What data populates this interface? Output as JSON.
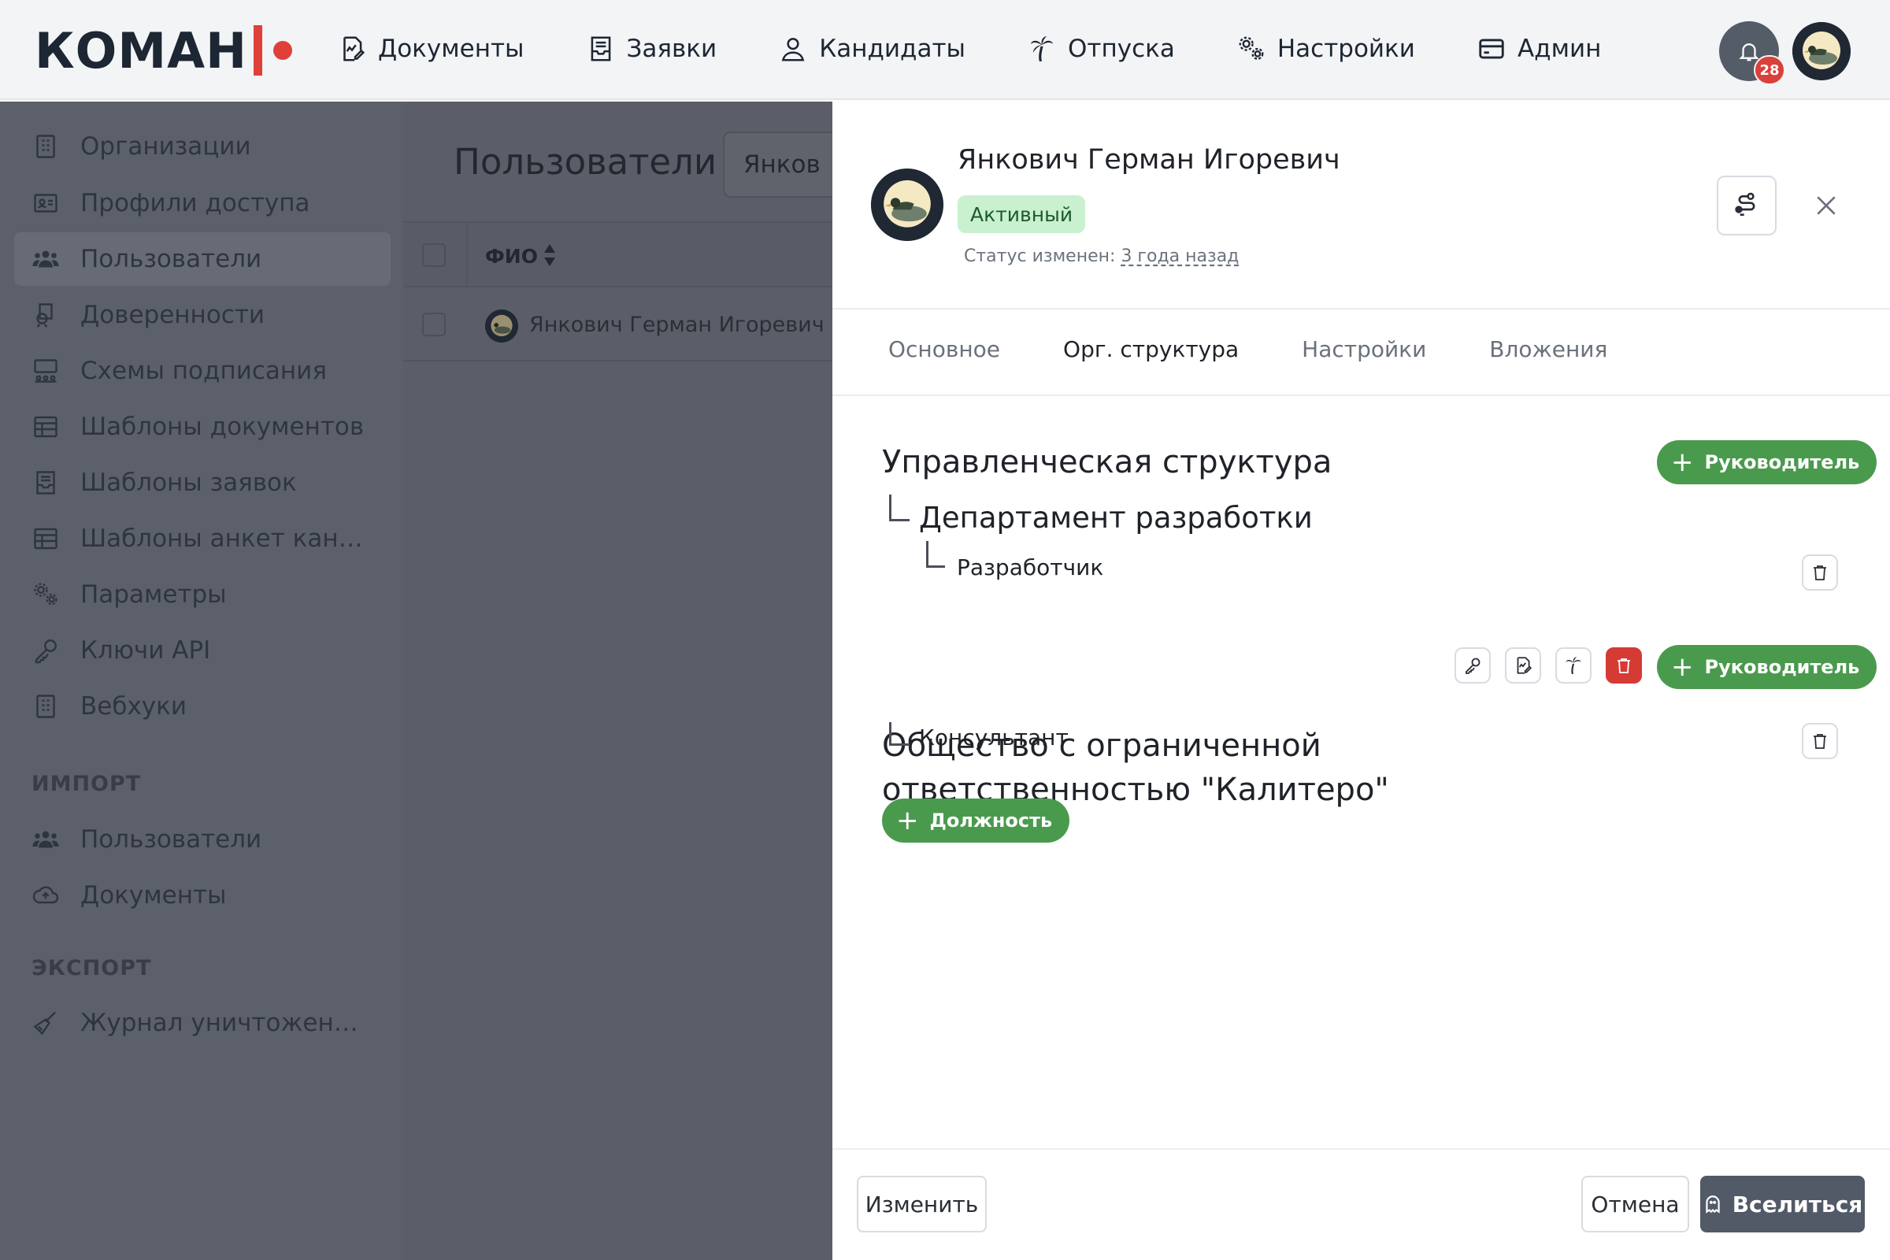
{
  "app": {
    "logo_text": "КОМАН",
    "notifications_count": "28",
    "nav": [
      {
        "label": "Документы",
        "icon": "document-sign-icon"
      },
      {
        "label": "Заявки",
        "icon": "inbox-icon"
      },
      {
        "label": "Кандидаты",
        "icon": "person-icon"
      },
      {
        "label": "Отпуска",
        "icon": "palm-tree-icon"
      },
      {
        "label": "Настройки",
        "icon": "gears-icon"
      },
      {
        "label": "Админ",
        "icon": "card-icon"
      }
    ]
  },
  "sidebar": {
    "items": [
      {
        "label": "Организации",
        "icon": "building-icon"
      },
      {
        "label": "Профили доступа",
        "icon": "id-card-icon"
      },
      {
        "label": "Пользователи",
        "icon": "users-icon"
      },
      {
        "label": "Доверенности",
        "icon": "power-of-attorney-icon"
      },
      {
        "label": "Схемы подписания",
        "icon": "signing-scheme-icon"
      },
      {
        "label": "Шаблоны документов",
        "icon": "table-icon"
      },
      {
        "label": "Шаблоны заявок",
        "icon": "inbox-icon"
      },
      {
        "label": "Шаблоны анкет канд...",
        "icon": "table-icon"
      },
      {
        "label": "Параметры",
        "icon": "gears-icon"
      },
      {
        "label": "Ключи API",
        "icon": "key-icon"
      },
      {
        "label": "Вебхуки",
        "icon": "building-icon"
      }
    ],
    "import_title": "ИМПОРТ",
    "import_items": [
      {
        "label": "Пользователи",
        "icon": "users-icon"
      },
      {
        "label": "Документы",
        "icon": "cloud-upload-icon"
      }
    ],
    "export_title": "ЭКСПОРТ",
    "export_items": [
      {
        "label": "Журнал уничтожения ...",
        "icon": "broom-icon"
      }
    ]
  },
  "main": {
    "title": "Пользователи",
    "search_value": "Янков",
    "table": {
      "columns": [
        "ФИО"
      ],
      "rows": [
        {
          "name": "Янкович Герман Игоревич"
        }
      ]
    }
  },
  "drawer": {
    "user_name": "Янкович Герман Игоревич",
    "status": "Активный",
    "status_changed_label": "Статус изменен:",
    "status_changed_value": "3 года назад",
    "tabs": [
      "Основное",
      "Орг. структура",
      "Настройки",
      "Вложения"
    ],
    "active_tab": "Орг. структура",
    "sections": [
      {
        "title": "Управленческая структура",
        "department": "Департамент разработки",
        "position": "Разработчик",
        "manager_button": "Руководитель"
      },
      {
        "title_line1": "Общество с ограниченной",
        "title_line2": "ответственностью \"Калитеро\"",
        "position": "Консультант",
        "manager_button": "Руководитель"
      }
    ],
    "add_position_button": "Должность",
    "footer": {
      "edit": "Изменить",
      "cancel": "Отмена",
      "impersonate": "Вселиться"
    }
  },
  "colors": {
    "accent_green": "#4a9a4e",
    "status_green_bg": "#c9f0cf",
    "danger_red": "#d63a35",
    "logo_red": "#e0403a",
    "overlay": "#5c606b"
  }
}
